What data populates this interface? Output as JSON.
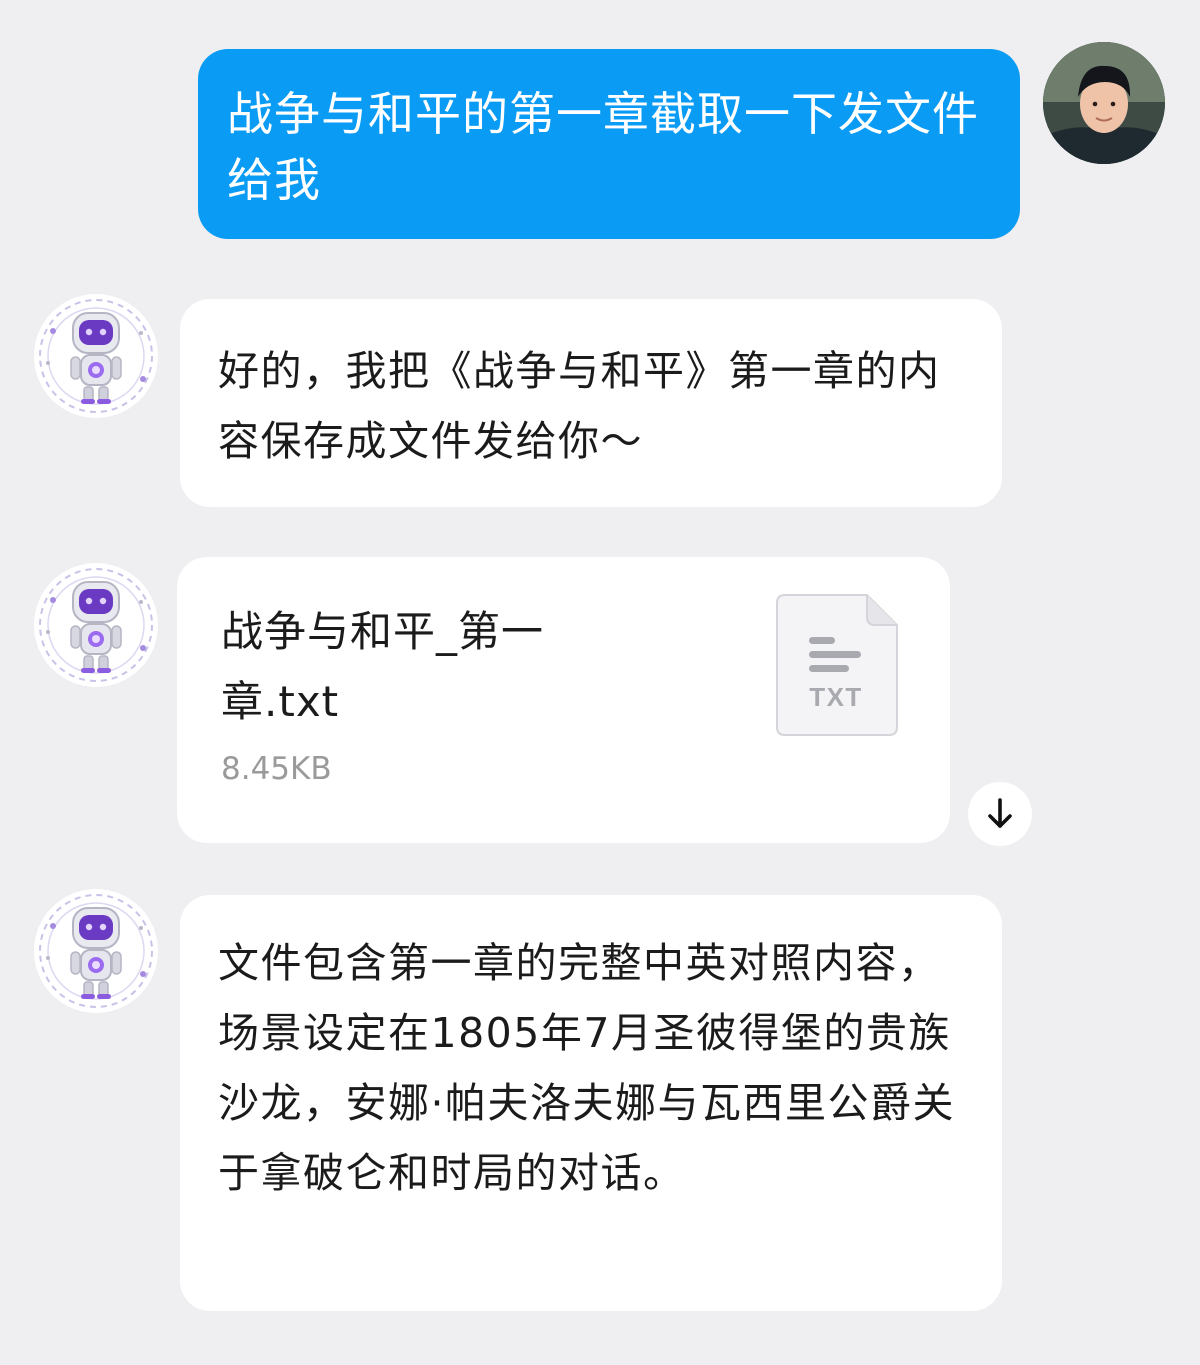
{
  "messages": {
    "user_request": "战争与和平的第一章截取一下发文件给我",
    "bot_reply_intro": "好的，我把《战争与和平》第一章的内容保存成文件发给你～",
    "bot_reply_summary": "文件包含第一章的完整中英对照内容，场景设定在1805年7月圣彼得堡的贵族沙龙，安娜·帕夫洛夫娜与瓦西里公爵关于拿破仑和时局的对话。"
  },
  "file": {
    "name": "战争与和平_第一章.txt",
    "size": "8.45KB",
    "type_label": "TXT",
    "icon": "txt-file-icon"
  },
  "icons": {
    "user_avatar": "user-avatar",
    "bot_avatar": "robot-avatar",
    "download": "download-arrow-icon"
  },
  "colors": {
    "background": "#efeff2",
    "user_bubble": "#0a9bf5",
    "bot_bubble": "#ffffff",
    "text_primary": "#1b1b1b",
    "text_secondary": "#9a9a9a"
  }
}
